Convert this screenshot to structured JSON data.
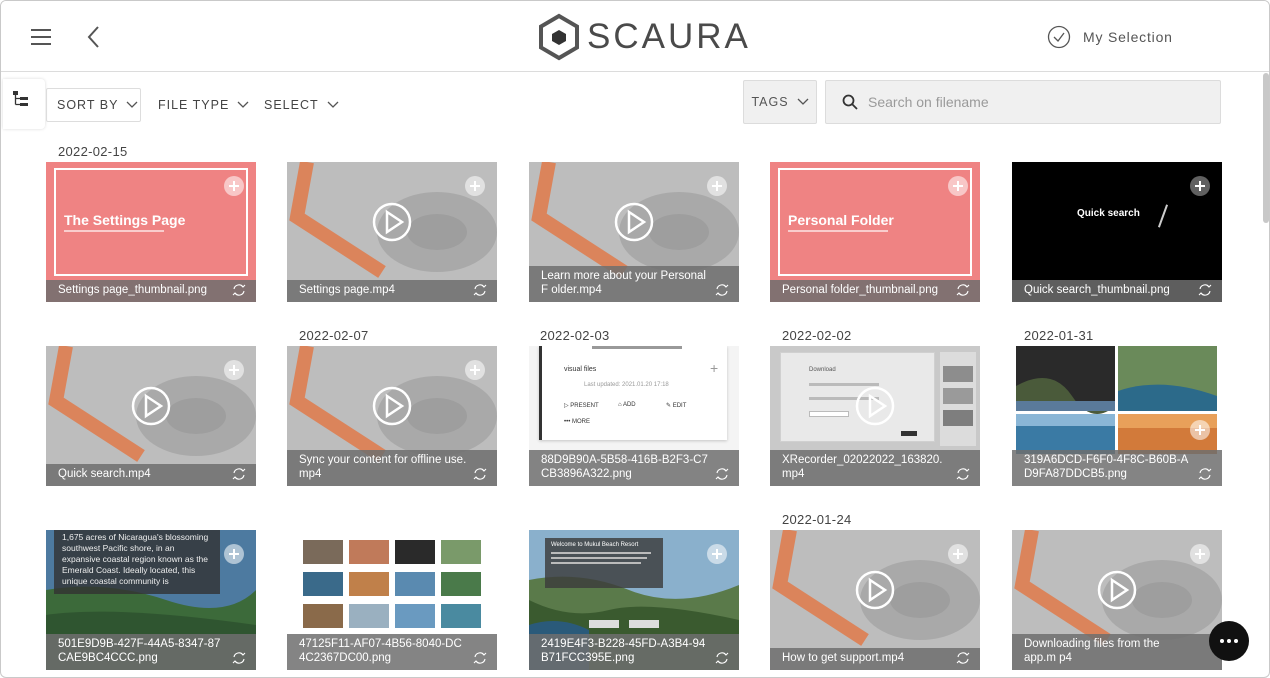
{
  "header": {
    "logo_text": "SCAURA",
    "my_selection_label": "My Selection"
  },
  "toolbar": {
    "sort_by_label": "SORT BY",
    "file_type_label": "FILE TYPE",
    "select_label": "SELECT",
    "tags_label": "TAGS",
    "search_placeholder": "Search on filename"
  },
  "dates": {
    "d1": "2022-02-15",
    "d2": "2022-02-07",
    "d3": "2022-02-03",
    "d4": "2022-02-02",
    "d5": "2022-01-31",
    "d6": "2022-01-24"
  },
  "thumb_text": {
    "settings_slide_title": "The Settings Page",
    "personal_slide_title": "Personal Folder",
    "quick_search_slide_title": "Quick search",
    "visual_files_title": "visual files",
    "visual_files_updated": "Last updated: 2021.01.20 17:18",
    "present_label": "PRESENT",
    "add_label": "ADD",
    "edit_label": "EDIT",
    "more_label": "MORE",
    "download_label": "Download",
    "nicaragua_text": "1,675 acres of Nicaragua's blossoming southwest Pacific shore, in an expansive coastal region known as the Emerald Coast. Ideally located, this unique coastal community is",
    "resort_title": "Welcome to Mukul Beach Resort"
  },
  "files": [
    {
      "name": "Settings page_thumbnail.png"
    },
    {
      "name": "Settings page.mp4"
    },
    {
      "name": "Learn more about your Personal F older.mp4"
    },
    {
      "name": "Personal folder_thumbnail.png"
    },
    {
      "name": "Quick search_thumbnail.png"
    },
    {
      "name": "Quick search.mp4"
    },
    {
      "name": "Sync your content for offline use. mp4"
    },
    {
      "name": "88D9B90A-5B58-416B-B2F3-C7 CB3896A322.png"
    },
    {
      "name": "XRecorder_02022022_163820. mp4"
    },
    {
      "name": "319A6DCD-F6F0-4F8C-B60B-A D9FA87DDCB5.png"
    },
    {
      "name": "501E9D9B-427F-44A5-8347-87 CAE9BC4CCC.png"
    },
    {
      "name": "47125F11-AF07-4B56-8040-DC 4C2367DC00.png"
    },
    {
      "name": "2419E4F3-B228-45FD-A3B4-94 B71FCC395E.png"
    },
    {
      "name": "How to get support.mp4"
    },
    {
      "name": "Downloading files from the app.m p4"
    }
  ],
  "colors": {
    "pink_slide": "#ef8383",
    "video_orange": "#e07a4a",
    "caption_bg": "#6e6e6e"
  }
}
